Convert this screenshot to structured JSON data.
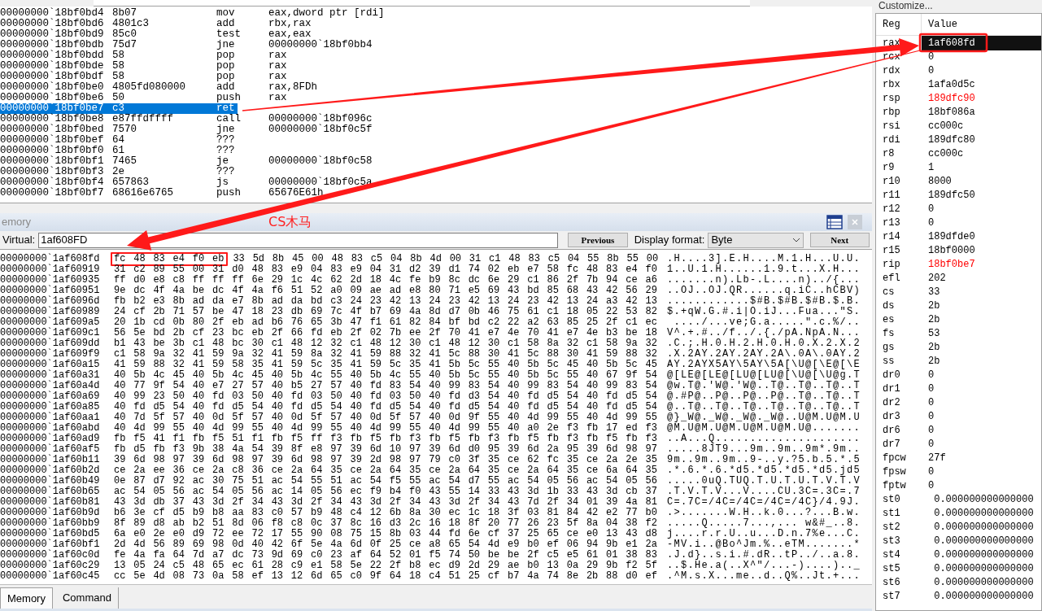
{
  "disassembly": {
    "rows": [
      {
        "address": "00000000`18bf0bd4",
        "bytes": "8b07",
        "mnemonic": "mov",
        "operands": "eax,dword ptr [rdi]",
        "selected": false
      },
      {
        "address": "00000000`18bf0bd6",
        "bytes": "4801c3",
        "mnemonic": "add",
        "operands": "rbx,rax",
        "selected": false
      },
      {
        "address": "00000000`18bf0bd9",
        "bytes": "85c0",
        "mnemonic": "test",
        "operands": "eax,eax",
        "selected": false
      },
      {
        "address": "00000000`18bf0bdb",
        "bytes": "75d7",
        "mnemonic": "jne",
        "operands": "00000000`18bf0bb4",
        "selected": false
      },
      {
        "address": "00000000`18bf0bdd",
        "bytes": "58",
        "mnemonic": "pop",
        "operands": "rax",
        "selected": false
      },
      {
        "address": "00000000`18bf0bde",
        "bytes": "58",
        "mnemonic": "pop",
        "operands": "rax",
        "selected": false
      },
      {
        "address": "00000000`18bf0bdf",
        "bytes": "58",
        "mnemonic": "pop",
        "operands": "rax",
        "selected": false
      },
      {
        "address": "00000000`18bf0be0",
        "bytes": "4805fd080000",
        "mnemonic": "add",
        "operands": "rax,8FDh",
        "selected": false
      },
      {
        "address": "00000000`18bf0be6",
        "bytes": "50",
        "mnemonic": "push",
        "operands": "rax",
        "selected": false
      },
      {
        "address": "00000000`18bf0be7",
        "bytes": "c3",
        "mnemonic": "ret",
        "selected": true
      },
      {
        "address": "00000000`18bf0be8",
        "bytes": "e87ffdffff",
        "mnemonic": "call",
        "operands": "00000000`18bf096c",
        "selected": false
      },
      {
        "address": "00000000`18bf0bed",
        "bytes": "7570",
        "mnemonic": "jne",
        "operands": "00000000`18bf0c5f",
        "selected": false
      },
      {
        "address": "00000000`18bf0bef",
        "bytes": "64",
        "mnemonic": "???",
        "selected": false
      },
      {
        "address": "00000000`18bf0bf0",
        "bytes": "61",
        "mnemonic": "???",
        "selected": false
      },
      {
        "address": "00000000`18bf0bf1",
        "bytes": "7465",
        "mnemonic": "je",
        "operands": "00000000`18bf0c58",
        "selected": false
      },
      {
        "address": "00000000`18bf0bf3",
        "bytes": "2e",
        "mnemonic": "???",
        "selected": false
      },
      {
        "address": "00000000`18bf0bf4",
        "bytes": "657863",
        "mnemonic": "js",
        "operands": "00000000`18bf0c5a",
        "selected": false
      },
      {
        "address": "00000000`18bf0bf7",
        "bytes": "68616e6765",
        "mnemonic": "push",
        "operands": "65676E61h",
        "selected": false
      }
    ]
  },
  "memory_window": {
    "title": "emory",
    "virtual_label": "Virtual:",
    "virtual_value": "1af608FD",
    "previous_button": "Previous",
    "display_format_label": "Display format:",
    "display_format_value": "Byte",
    "next_button": "Next",
    "rows": [
      {
        "address": "00000000`1af608fd",
        "marked_bytes": "fc 48 83 e4 f0 eb",
        "bytes": "33 5d 8b 45 00 48 83 c5 04 8b 4d 00 31 c1 48 83 c5 04 55 8b 55 00",
        "ascii": ".H....3].E.H....M.1.H...U.U."
      },
      {
        "address": "00000000`1af60919",
        "bytes": "31 c2 89 55 00 31 d0 48 83 e9 04 83 e9 04 31 d2 39 d1 74 02 eb e7 58 fc 48 83 e4 f0",
        "ascii": "1..U.1.H......1.9.t...X.H..."
      },
      {
        "address": "00000000`1af60935",
        "bytes": "ff d0 e8 c8 ff ff ff 6e 29 1c 4c 62 2d 18 4c fe b9 8c dc 6e 29 c1 86 2f 7b 94 ce a6",
        "ascii": ".......n).Lb-.L....n)../{..."
      },
      {
        "address": "00000000`1af60951",
        "bytes": "9e dc 4f 4a be dc 4f 4a f6 51 52 a0 09 ae ad e8 80 71 e5 69 43 bd 85 68 43 42 56 29",
        "ascii": "..OJ..OJ.QR......q.iC..hCBV)"
      },
      {
        "address": "00000000`1af6096d",
        "bytes": "fb b2 e3 8b ad da e7 8b ad da bd c3 24 23 42 13 24 23 42 13 24 23 42 13 24 a3 42 13",
        "ascii": "............$#B.$#B.$#B.$.B."
      },
      {
        "address": "00000000`1af60989",
        "bytes": "24 cf 2b 71 57 be 47 18 23 db 69 7c 4f b7 69 4a 8d d7 0b 46 75 61 c1 18 05 22 53 82",
        "ascii": "$.+qW.G.#.i|O.iJ...Fua...\"S."
      },
      {
        "address": "00000000`1af609a5",
        "bytes": "20 1b cd 0b 80 2f eb ad b6 76 65 3b 47 f1 61 82 84 bf bd c2 22 a2 63 85 25 2f c1 ec",
        "ascii": " ..../...ve;G.a.....\".c.%/.."
      },
      {
        "address": "00000000`1af609c1",
        "bytes": "56 5e bd 2b cf 23 bc eb 2f 66 fd eb 2f 02 7b ee 2f 70 41 e7 4e 70 41 e7 4e b3 be 18",
        "ascii": "V^.+.#../f../.{./pA.NpA.N..."
      },
      {
        "address": "00000000`1af609dd",
        "bytes": "b1 43 be 3b c1 48 bc 30 c1 48 12 32 c1 48 12 30 c1 48 12 30 c1 58 8a 32 c1 58 9a 32",
        "ascii": ".C.;.H.0.H.2.H.0.H.0.X.2.X.2"
      },
      {
        "address": "00000000`1af609f9",
        "bytes": "c1 58 9a 32 41 59 9a 32 41 59 8a 32 41 59 88 32 41 5c 88 30 41 5c 88 30 41 59 88 32",
        "ascii": ".X.2AY.2AY.2AY.2A\\.0A\\.0AY.2"
      },
      {
        "address": "00000000`1af60a15",
        "bytes": "41 59 88 32 41 59 58 35 41 59 5c 35 41 59 5c 35 41 5b 5c 55 40 5b 5c 45 40 5b 5c 45",
        "ascii": "AY.2AYX5AY\\5AY\\5A[\\U@[\\E@[\\E"
      },
      {
        "address": "00000000`1af60a31",
        "bytes": "40 5b 4c 45 40 5b 4c 45 40 5b 4c 55 40 5b 4c 55 40 5b 5c 55 40 5b 5c 55 40 67 9f 54",
        "ascii": "@[LE@[LE@[LU@[LU@[\\U@[\\U@g.T"
      },
      {
        "address": "00000000`1af60a4d",
        "bytes": "40 77 9f 54 40 e7 27 57 40 b5 27 57 40 fd 83 54 40 99 83 54 40 99 83 54 40 99 83 54",
        "ascii": "@w.T@.'W@.'W@..T@..T@..T@..T"
      },
      {
        "address": "00000000`1af60a69",
        "bytes": "40 99 23 50 40 fd 03 50 40 fd 03 50 40 fd 03 50 40 fd d3 54 40 fd d5 54 40 fd d5 54",
        "ascii": "@.#P@..P@..P@..P@..T@..T@..T"
      },
      {
        "address": "00000000`1af60a85",
        "bytes": "40 fd d5 54 40 fd d5 54 40 fd d5 54 40 fd d5 54 40 fd d5 54 40 fd d5 54 40 fd d5 54",
        "ascii": "@..T@..T@..T@..T@..T@..T@..T"
      },
      {
        "address": "00000000`1af60aa1",
        "bytes": "40 7d 5f 57 40 0d 5f 57 40 0d 5f 57 40 0d 5f 57 40 0d 9f 55 40 4d 99 55 40 4d 99 55",
        "ascii": "@}_W@._W@._W@._W@..U@M.U@M.U"
      },
      {
        "address": "00000000`1af60abd",
        "bytes": "40 4d 99 55 40 4d 99 55 40 4d 99 55 40 4d 99 55 40 4d 99 55 40 a0 2e f3 fb 17 ed f3",
        "ascii": "@M.U@M.U@M.U@M.U@M.U@......."
      },
      {
        "address": "00000000`1af60ad9",
        "bytes": "fb f5 41 f1 fb f5 51 f1 fb f5 ff f3 fb f5 fb f3 fb f5 fb f3 fb f5 fb f3 fb f5 fb f3",
        "ascii": "..A...Q....................."
      },
      {
        "address": "00000000`1af60af5",
        "bytes": "fb d5 fb f3 9b 38 4a 54 39 8f e8 97 39 6d 10 97 39 6d d0 95 39 6d 2a 95 39 6d 98 97",
        "ascii": ".....8JT9...9m..9m..9m*.9m.."
      },
      {
        "address": "00000000`1af60b11",
        "bytes": "39 6d 98 97 39 6d 98 97 39 6d 98 97 39 2d 98 97 79 c0 3f 35 ce 62 fc 35 ce 2a 2e 35",
        "ascii": "9m..9m..9m..9-..y.?5.b.5.*.5"
      },
      {
        "address": "00000000`1af60b2d",
        "bytes": "ce 2a ee 36 ce 2a c8 36 ce 2a 64 35 ce 2a 64 35 ce 2a 64 35 ce 2a 64 35 ce 6a 64 35",
        "ascii": ".*.6.*.6.*d5.*d5.*d5.*d5.jd5"
      },
      {
        "address": "00000000`1af60b49",
        "bytes": "0e 87 d7 92 ac 30 75 51 ac 54 55 51 ac 54 f5 55 ac 54 d7 55 ac 54 05 56 ac 54 05 56",
        "ascii": ".....0uQ.TUQ.T.U.T.U.T.V.T.V"
      },
      {
        "address": "00000000`1af60b65",
        "bytes": "ac 54 05 56 ac 54 05 56 ac 14 05 56 ec f9 b4 f0 43 55 14 33 43 3d 1b 33 43 3d cb 37",
        "ascii": ".T.V.T.V...V....CU.3C=.3C=.7"
      },
      {
        "address": "00000000`1af60b81",
        "bytes": "43 3d db 37 43 3d 2f 34 43 3d 2f 34 43 3d 2f 34 43 3d 2f 34 43 7d 2f 34 01 39 4a 81",
        "ascii": "C=.7C=/4C=/4C=/4C=/4C}/4.9J."
      },
      {
        "address": "00000000`1af60b9d",
        "bytes": "b6 3e cf d5 b9 b8 aa 83 c0 57 b9 48 c4 12 6b 8a 30 ec 1c 18 3f 03 81 84 42 e2 77 b0",
        "ascii": ".>.......W.H..k.0...?...B.w."
      },
      {
        "address": "00000000`1af60bb9",
        "bytes": "8f 89 d8 ab b2 51 8d 06 f8 c8 0c 37 8c 16 d3 2c 16 18 8f 20 77 26 23 5f 8a 04 38 f2",
        "ascii": ".....Q.....7...,... w&#_..8."
      },
      {
        "address": "00000000`1af60bd5",
        "bytes": "6a e0 2e e0 d9 72 ee 72 17 55 90 08 75 15 8b 03 44 fd 6e cf 37 25 65 ce e0 13 43 d8",
        "ascii": "j....r.r.U..u...D.n.7%e...C."
      },
      {
        "address": "00000000`1af60bf1",
        "bytes": "2d 4d 56 89 69 98 0d 40 42 6f 5e 4a 6d 0f 25 ce a8 65 54 4d e9 b0 ef 06 94 9b e1 2a",
        "ascii": "-MV.i..@Bo^Jm.%..eTM.......*"
      },
      {
        "address": "00000000`1af60c0d",
        "bytes": "fe 4a fa 64 7d a7 dc 73 9d 69 c0 23 af 64 52 01 f5 74 50 be be 2f c5 e5 61 01 38 83",
        "ascii": ".J.d}..s.i.#.dR..tP../..a.8."
      },
      {
        "address": "00000000`1af60c29",
        "bytes": "13 05 24 c5 48 65 ec 61 28 c9 e1 58 5e 22 2f b8 ec d9 2d 29 ae b0 13 0a 29 9b f2 5f",
        "ascii": "..$.He.a(..X^\"/...-)....).._"
      },
      {
        "address": "00000000`1af60c45",
        "bytes": "cc 5e 4d 08 73 0a 58 ef 13 12 6d 65 c0 9f 64 18 c4 51 25 cf b7 4a 74 8e 2b 88 d0 ef",
        "ascii": ".^M.s.X...me..d..Q%..Jt.+..."
      }
    ]
  },
  "bottom_tabs": [
    {
      "label": "Memory",
      "selected": true
    },
    {
      "label": "Command",
      "selected": false
    }
  ],
  "registers": {
    "customize": "Customize...",
    "columns": [
      "Reg",
      "Value"
    ],
    "rows": [
      {
        "name": "rax",
        "value": "1af608fd",
        "selected": true,
        "changed": false
      },
      {
        "name": "rcx",
        "value": "0",
        "selected": false,
        "changed": false
      },
      {
        "name": "rdx",
        "value": "0",
        "selected": false,
        "changed": false
      },
      {
        "name": "rbx",
        "value": "1afa0d5c",
        "selected": false,
        "changed": false
      },
      {
        "name": "rsp",
        "value": "189dfc90",
        "selected": false,
        "changed": true
      },
      {
        "name": "rbp",
        "value": "18bf086a",
        "selected": false,
        "changed": false
      },
      {
        "name": "rsi",
        "value": "cc000c",
        "selected": false,
        "changed": false
      },
      {
        "name": "rdi",
        "value": "189dfc80",
        "selected": false,
        "changed": false
      },
      {
        "name": "r8",
        "value": "cc000c",
        "selected": false,
        "changed": false
      },
      {
        "name": "r9",
        "value": "1",
        "selected": false,
        "changed": false
      },
      {
        "name": "r10",
        "value": "8000",
        "selected": false,
        "changed": false
      },
      {
        "name": "r11",
        "value": "189dfc50",
        "selected": false,
        "changed": false
      },
      {
        "name": "r12",
        "value": "0",
        "selected": false,
        "changed": false
      },
      {
        "name": "r13",
        "value": "0",
        "selected": false,
        "changed": false
      },
      {
        "name": "r14",
        "value": "189dfde0",
        "selected": false,
        "changed": false
      },
      {
        "name": "r15",
        "value": "18bf0000",
        "selected": false,
        "changed": false
      },
      {
        "name": "rip",
        "value": "18bf0be7",
        "selected": false,
        "changed": true
      },
      {
        "name": "efl",
        "value": "202",
        "selected": false,
        "changed": false
      },
      {
        "name": "cs",
        "value": "33",
        "selected": false,
        "changed": false
      },
      {
        "name": "ds",
        "value": "2b",
        "selected": false,
        "changed": false
      },
      {
        "name": "es",
        "value": "2b",
        "selected": false,
        "changed": false
      },
      {
        "name": "fs",
        "value": "53",
        "selected": false,
        "changed": false
      },
      {
        "name": "gs",
        "value": "2b",
        "selected": false,
        "changed": false
      },
      {
        "name": "ss",
        "value": "2b",
        "selected": false,
        "changed": false
      },
      {
        "name": "dr0",
        "value": "0",
        "selected": false,
        "changed": false
      },
      {
        "name": "dr1",
        "value": "0",
        "selected": false,
        "changed": false
      },
      {
        "name": "dr2",
        "value": "0",
        "selected": false,
        "changed": false
      },
      {
        "name": "dr3",
        "value": "0",
        "selected": false,
        "changed": false
      },
      {
        "name": "dr6",
        "value": "0",
        "selected": false,
        "changed": false
      },
      {
        "name": "dr7",
        "value": "0",
        "selected": false,
        "changed": false
      },
      {
        "name": "fpcw",
        "value": "27f",
        "selected": false,
        "changed": false
      },
      {
        "name": "fpsw",
        "value": "0",
        "selected": false,
        "changed": false
      },
      {
        "name": "fptw",
        "value": "0",
        "selected": false,
        "changed": false
      },
      {
        "name": "st0",
        "value": " 0.000000000000000",
        "selected": false,
        "changed": false
      },
      {
        "name": "st1",
        "value": " 0.000000000000000",
        "selected": false,
        "changed": false
      },
      {
        "name": "st2",
        "value": " 0.000000000000000",
        "selected": false,
        "changed": false
      },
      {
        "name": "st3",
        "value": " 0.000000000000000",
        "selected": false,
        "changed": false
      },
      {
        "name": "st4",
        "value": " 0.000000000000000",
        "selected": false,
        "changed": false
      },
      {
        "name": "st5",
        "value": " 0.000000000000000",
        "selected": false,
        "changed": false
      },
      {
        "name": "st6",
        "value": " 0.000000000000000",
        "selected": false,
        "changed": false
      },
      {
        "name": "st7",
        "value": " 0.000000000000000",
        "selected": false,
        "changed": false
      }
    ]
  },
  "annotation": {
    "label": "CS木马"
  }
}
